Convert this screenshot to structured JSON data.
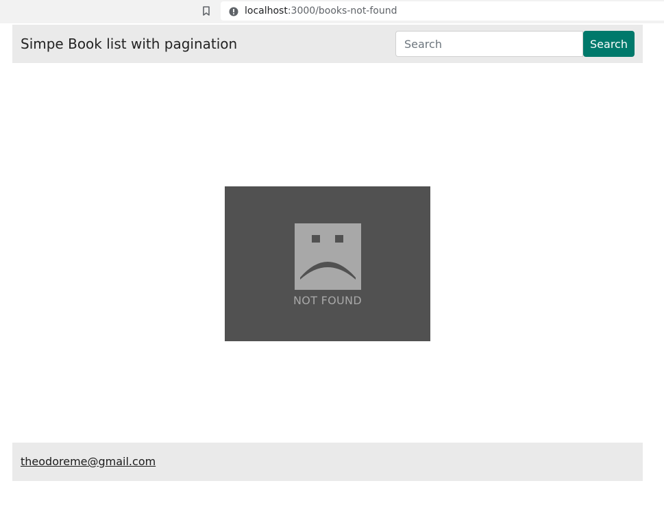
{
  "browser": {
    "url_host": "localhost",
    "url_path": ":3000/books-not-found",
    "bookmark_icon": "bookmark-icon",
    "info_icon": "info-icon"
  },
  "navbar": {
    "brand": "Simpe Book list with pagination",
    "search_placeholder": "Search",
    "search_value": "",
    "search_button_label": "Search",
    "accent_color": "#00796b"
  },
  "main": {
    "image_icon": "sad-face-icon",
    "image_caption": "NOT FOUND"
  },
  "footer": {
    "email": "theodoreme@gmail.com"
  }
}
